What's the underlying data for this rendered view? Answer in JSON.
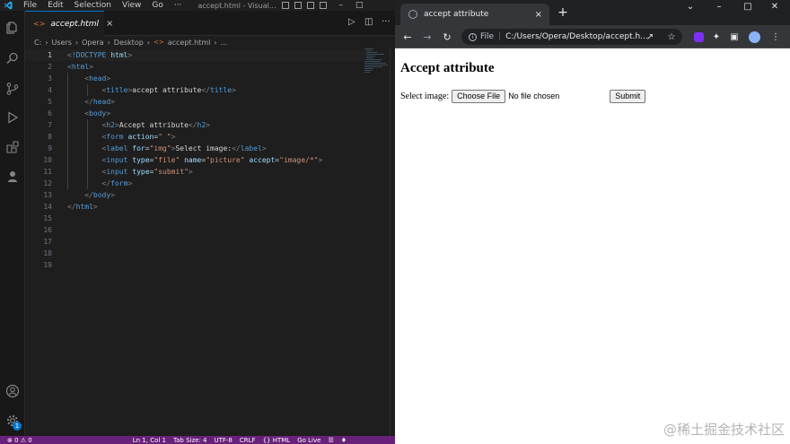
{
  "vscode": {
    "menu": [
      "File",
      "Edit",
      "Selection",
      "View",
      "Go",
      "···"
    ],
    "window_title": "accept.html - Visual...",
    "tab": {
      "label": "accept.html",
      "close": "×"
    },
    "breadcrumb": [
      "C:",
      "Users",
      "Opera",
      "Desktop",
      "accept.html",
      "..."
    ],
    "line_numbers": [
      "1",
      "2",
      "3",
      "4",
      "5",
      "6",
      "7",
      "8",
      "9",
      "10",
      "11",
      "12",
      "13",
      "14",
      "15",
      "16",
      "17",
      "18",
      "19"
    ],
    "status": {
      "problems": "⊗ 0 ⚠ 0",
      "position": "Ln 1, Col 1",
      "tab_size": "Tab Size: 4",
      "encoding": "UTF-8",
      "eol": "CRLF",
      "language": "{} HTML",
      "go_live": "Go Live"
    },
    "settings_badge": "1",
    "colors": {
      "accent": "#0078d4",
      "statusbar": "#68217a",
      "tag": "#569cd6",
      "attr": "#9cdcfe",
      "string": "#ce9178"
    }
  },
  "chrome": {
    "tab_title": "accept attribute",
    "tab_close": "×",
    "new_tab": "+",
    "scheme_label": "File",
    "url": "C:/Users/Opera/Desktop/accept.h...",
    "icons": [
      "back-icon",
      "forward-icon",
      "reload-icon",
      "share-icon",
      "star-icon",
      "extension-icon",
      "puzzle-icon",
      "sidepanel-icon",
      "profile-avatar",
      "kebab-menu-icon"
    ]
  },
  "page": {
    "heading": "Accept attribute",
    "label": "Select image:",
    "choose_file": "Choose File",
    "file_status": "No file chosen",
    "submit": "Submit"
  },
  "watermark": "@稀土掘金技术社区"
}
